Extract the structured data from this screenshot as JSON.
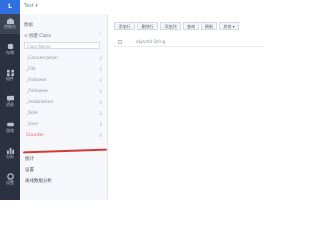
{
  "topbar": {
    "logo": "L",
    "app_label": "Test ▾"
  },
  "rail": [
    {
      "label": "控制台",
      "icon": "home-icon"
    },
    {
      "label": "存储",
      "icon": "database-icon"
    },
    {
      "label": "组件",
      "icon": "components-icon"
    },
    {
      "label": "消息",
      "icon": "message-icon"
    },
    {
      "label": "游戏",
      "icon": "gamepad-icon"
    },
    {
      "label": "分析",
      "icon": "chart-icon"
    },
    {
      "label": "设置",
      "icon": "gear-icon"
    }
  ],
  "sidebar": {
    "section_title": "数据",
    "create_label": "创建 Class",
    "search_placeholder": "Class Name",
    "classes": [
      {
        "name": "_Conversation",
        "count": "0"
      },
      {
        "name": "_File",
        "count": "0"
      },
      {
        "name": "_Follower",
        "count": "0"
      },
      {
        "name": "_Followee",
        "count": "0"
      },
      {
        "name": "_Installation",
        "count": "0"
      },
      {
        "name": "_Role",
        "count": "0"
      },
      {
        "name": "_User",
        "count": "0"
      },
      {
        "name": "Counter",
        "count": "0"
      }
    ],
    "bottom": [
      "统计",
      "设置",
      "离线数据分析"
    ]
  },
  "toolbar": [
    "添加行",
    "删除行",
    "添加列",
    "查询",
    "刷新",
    "其他 ▾"
  ],
  "grid": {
    "column": "objectId  String"
  }
}
